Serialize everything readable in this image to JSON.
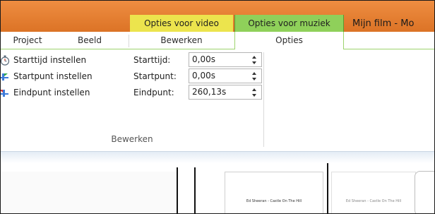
{
  "title_strip": {
    "context_tabs": {
      "video": "Opties voor video",
      "music": "Opties voor muziek"
    },
    "app_title": "Mijn film - Mo"
  },
  "tabs": {
    "project": "Project",
    "beeld": "Beeld",
    "bewerken": "Bewerken",
    "opties": "Opties"
  },
  "ribbon": {
    "buttons": {
      "set_start_time": "Starttijd instellen",
      "set_start_point": "Startpunt instellen",
      "set_end_point": "Eindpunt instellen"
    },
    "fields": {
      "start_time": {
        "label": "Starttijd:",
        "value": "0,00s"
      },
      "start_point": {
        "label": "Startpunt:",
        "value": "0,00s"
      },
      "end_point": {
        "label": "Eindpunt:",
        "value": "260,13s"
      }
    },
    "group_label": "Bewerken"
  },
  "storyboard": {
    "thumb_caption_1": "Ed Sheeran - Castle On The Hill",
    "thumb_caption_2": "Ed Sheeran - Castle On The Hill"
  },
  "colors": {
    "title_orange": "#e57f33",
    "video_context": "#ece44d",
    "music_context": "#8fd05a",
    "accent_green": "#9dd36d"
  },
  "icons": {
    "set_start_time": "stopwatch-icon",
    "set_start_point": "start-point-icon",
    "set_end_point": "end-point-icon",
    "spinner_up": "spin-up-icon",
    "spinner_down": "spin-down-icon"
  }
}
